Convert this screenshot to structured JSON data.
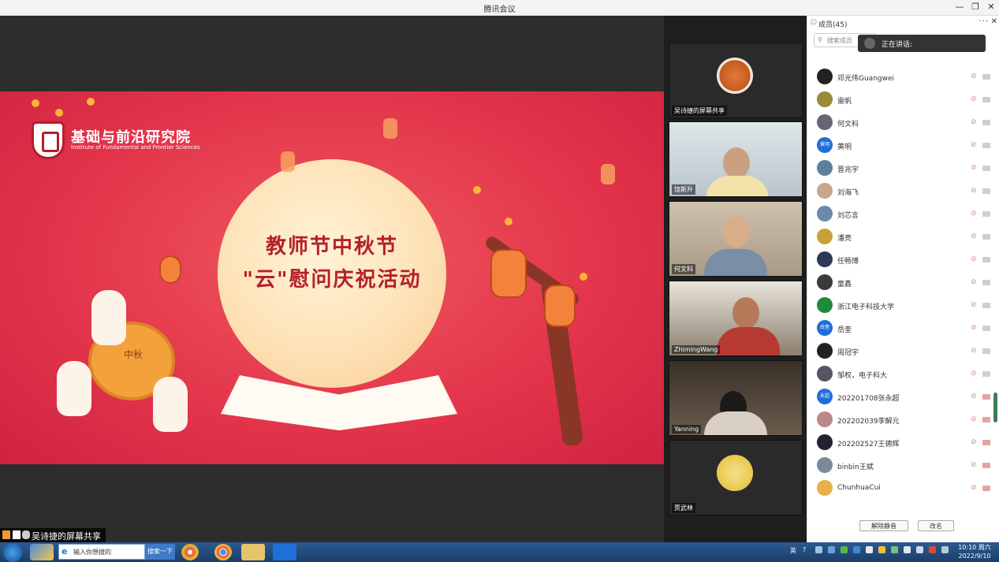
{
  "window": {
    "title": "腾讯会议",
    "minimize": "—",
    "restore": "❐",
    "close": "✕"
  },
  "slide": {
    "logo_cn": "基础与前沿研究院",
    "logo_en": "Institute of Fundamental and Frontier Sciences",
    "title_line1": "教师节中秋节",
    "title_line2": "\"云\"慰问庆祝活动",
    "mooncake_text": "中秋"
  },
  "share_label": "吴诗捷的屏幕共享",
  "tiles": [
    {
      "name": "吴诗捷的屏幕共享",
      "kind": "avatar"
    },
    {
      "name": "饶斯升",
      "kind": "video"
    },
    {
      "name": "何文科",
      "kind": "video"
    },
    {
      "name": "ZhimingWang",
      "kind": "video"
    },
    {
      "name": "Yanning",
      "kind": "video"
    },
    {
      "name": "贾武林",
      "kind": "avatar"
    }
  ],
  "panel": {
    "title": "成员(45)",
    "more": "···",
    "close": "✕",
    "search_placeholder": "搜索成员",
    "speaking_label": "正在讲话:",
    "members": [
      {
        "name": "邓光伟Guangwei",
        "color": "#222",
        "initials": ""
      },
      {
        "name": "雷帆",
        "color": "#9a8a3a",
        "initials": ""
      },
      {
        "name": "何文科",
        "color": "#667",
        "initials": ""
      },
      {
        "name": "黄明",
        "color": "#1e6fd9",
        "initials": "黄明"
      },
      {
        "name": "晋兆宇",
        "color": "#5d7f9e",
        "initials": ""
      },
      {
        "name": "刘海飞",
        "color": "#c9a58a",
        "initials": ""
      },
      {
        "name": "刘芯言",
        "color": "#6a8aa8",
        "initials": ""
      },
      {
        "name": "潘亮",
        "color": "#c7a037",
        "initials": ""
      },
      {
        "name": "任畅博",
        "color": "#2b3a55",
        "initials": ""
      },
      {
        "name": "童鑫",
        "color": "#3a3a3a",
        "initials": ""
      },
      {
        "name": "浙江电子科技大学",
        "color": "#1f8a3c",
        "initials": ""
      },
      {
        "name": "岳奎",
        "color": "#1e6fd9",
        "initials": "岳奎"
      },
      {
        "name": "周冠宇",
        "color": "#222",
        "initials": ""
      },
      {
        "name": "邹权，电子科大",
        "color": "#556",
        "initials": ""
      },
      {
        "name": "202201708张永超",
        "color": "#1e6fd9",
        "initials": "永超"
      },
      {
        "name": "202202039李解元",
        "color": "#b88",
        "initials": ""
      },
      {
        "name": "202202527王德辉",
        "color": "#223",
        "initials": ""
      },
      {
        "name": "binbin王斌",
        "color": "#7a8a9a",
        "initials": ""
      },
      {
        "name": "ChunhuaCui",
        "color": "#e8b04a",
        "initials": ""
      }
    ],
    "unmute_all": "解除静音",
    "rename": "改名"
  },
  "taskbar": {
    "search_placeholder": "输入你想搜的",
    "search_button": "搜索一下",
    "lang": "英",
    "help": "?",
    "clock_time": "10:10 周六",
    "clock_date": "2022/9/10"
  },
  "colors": {
    "slide_red": "#e2334a",
    "title_red": "#b3202c",
    "tencent_blue": "#1e6fd9"
  }
}
